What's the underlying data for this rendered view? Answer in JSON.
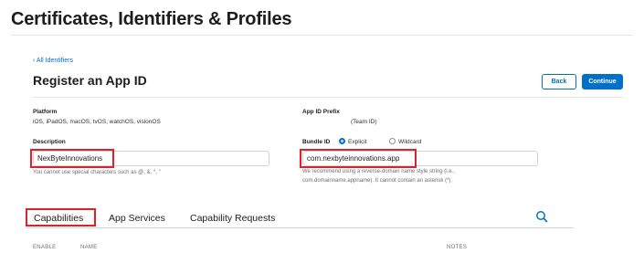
{
  "header": {
    "title": "Certificates, Identifiers & Profiles"
  },
  "nav": {
    "back_link": "‹ All Identifiers"
  },
  "register": {
    "title": "Register an App ID",
    "back_label": "Back",
    "continue_label": "Continue"
  },
  "platform": {
    "label": "Platform",
    "value": "iOS, iPadOS, macOS, tvOS, watchOS, visionOS"
  },
  "prefix": {
    "label": "App ID Prefix",
    "value": "(Team ID)"
  },
  "description": {
    "label": "Description",
    "value": "NexByteInnovations",
    "help": "You cannot use special characters such as @, &, *, \""
  },
  "bundle": {
    "label": "Bundle ID",
    "option_explicit": "Explicit",
    "option_wildcard": "Wildcard",
    "selected": "Explicit",
    "value": "com.nexbyteinnovations.app",
    "help_line1": "We recommend using a reverse-domain name style string (i.e.,",
    "help_line2": "com.domainname.appname). It cannot contain an asterisk (*)."
  },
  "tabs": [
    {
      "label": "Capabilities",
      "active": true
    },
    {
      "label": "App Services",
      "active": false
    },
    {
      "label": "Capability Requests",
      "active": false
    }
  ],
  "table": {
    "col_enable": "ENABLE",
    "col_name": "NAME",
    "col_notes": "NOTES"
  },
  "colors": {
    "accent": "#0070c9",
    "highlight": "#e0202a"
  }
}
